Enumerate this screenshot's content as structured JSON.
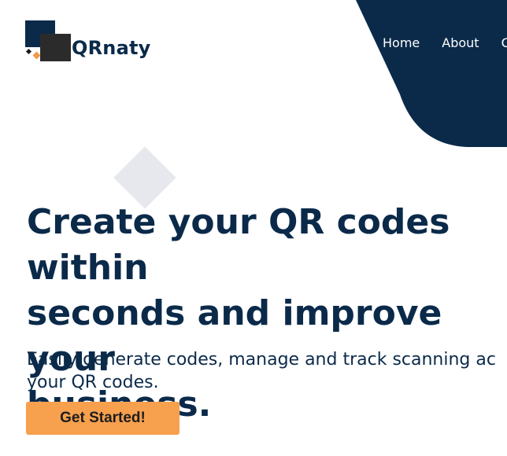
{
  "brand": {
    "name": "QRnaty",
    "logo_icon": "qrnaty-logo-icon"
  },
  "nav": {
    "items": [
      {
        "label": "Home"
      },
      {
        "label": "About"
      },
      {
        "label": "C"
      }
    ]
  },
  "hero": {
    "headline": "Create your QR codes within\nseconds and improve your\nbusiness.",
    "subtext": "Easily generate codes, manage and track scanning ac\nyour QR codes.",
    "cta_label": "Get Started!"
  },
  "colors": {
    "navy": "#0b2a4a",
    "accent_orange": "#f7a04e",
    "diamond_gray": "#e6e8ee",
    "background": "#ffffff"
  }
}
